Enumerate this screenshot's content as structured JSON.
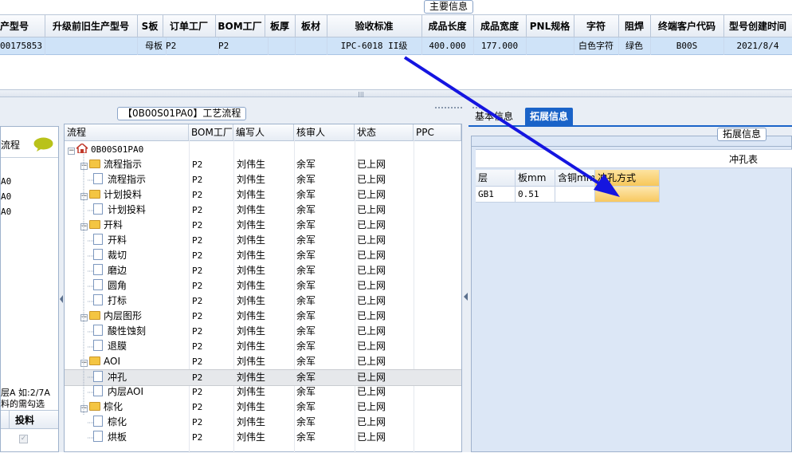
{
  "top": {
    "group_label": "主要信息",
    "headers": [
      "产型号",
      "升级前旧生产型号",
      "S板",
      "订单工厂",
      "BOM工厂",
      "板厚",
      "板材",
      "验收标准",
      "成品长度",
      "成品宽度",
      "PNL规格",
      "字符",
      "阻焊",
      "终端客户代码",
      "型号创建时间"
    ],
    "row": [
      "00175853",
      "",
      "母板",
      "P2",
      "P2",
      "",
      "",
      "IPC-6018 II级",
      "400.000",
      "177.000",
      "",
      "白色字符",
      "绿色",
      "B00S",
      "2021/8/4"
    ]
  },
  "left": {
    "label_process": "流程",
    "items": [
      "A0",
      "A0",
      "A0"
    ],
    "note_line1": "层A 如:2/7A",
    "note_line2": "料的需勾选",
    "col_header": "投料"
  },
  "tree": {
    "group_label": "【0B00S01PA0】工艺流程",
    "headers": [
      "流程",
      "BOM工厂",
      "编写人",
      "核审人",
      "状态",
      "PPC"
    ],
    "root": "0B00S01PA0",
    "rows": [
      {
        "label": "流程指示",
        "type": "folder",
        "bom": "P2",
        "writer": "刘伟生",
        "reviewer": "余军",
        "status": "已上网"
      },
      {
        "label": "流程指示",
        "type": "doc",
        "bom": "P2",
        "writer": "刘伟生",
        "reviewer": "余军",
        "status": "已上网"
      },
      {
        "label": "计划投料",
        "type": "folder",
        "bom": "P2",
        "writer": "刘伟生",
        "reviewer": "余军",
        "status": "已上网"
      },
      {
        "label": "计划投料",
        "type": "doc",
        "bom": "P2",
        "writer": "刘伟生",
        "reviewer": "余军",
        "status": "已上网"
      },
      {
        "label": "开料",
        "type": "folder",
        "bom": "P2",
        "writer": "刘伟生",
        "reviewer": "余军",
        "status": "已上网"
      },
      {
        "label": "开料",
        "type": "doc",
        "bom": "P2",
        "writer": "刘伟生",
        "reviewer": "余军",
        "status": "已上网"
      },
      {
        "label": "裁切",
        "type": "doc",
        "bom": "P2",
        "writer": "刘伟生",
        "reviewer": "余军",
        "status": "已上网"
      },
      {
        "label": "磨边",
        "type": "doc",
        "bom": "P2",
        "writer": "刘伟生",
        "reviewer": "余军",
        "status": "已上网"
      },
      {
        "label": "圆角",
        "type": "doc",
        "bom": "P2",
        "writer": "刘伟生",
        "reviewer": "余军",
        "status": "已上网"
      },
      {
        "label": "打标",
        "type": "doc",
        "bom": "P2",
        "writer": "刘伟生",
        "reviewer": "余军",
        "status": "已上网"
      },
      {
        "label": "内层图形",
        "type": "folder",
        "bom": "P2",
        "writer": "刘伟生",
        "reviewer": "余军",
        "status": "已上网"
      },
      {
        "label": "酸性蚀刻",
        "type": "doc",
        "bom": "P2",
        "writer": "刘伟生",
        "reviewer": "余军",
        "status": "已上网"
      },
      {
        "label": "退膜",
        "type": "doc",
        "bom": "P2",
        "writer": "刘伟生",
        "reviewer": "余军",
        "status": "已上网"
      },
      {
        "label": "AOI",
        "type": "folder",
        "bom": "P2",
        "writer": "刘伟生",
        "reviewer": "余军",
        "status": "已上网"
      },
      {
        "label": "冲孔",
        "type": "doc",
        "bom": "P2",
        "writer": "刘伟生",
        "reviewer": "余军",
        "status": "已上网",
        "selected": true
      },
      {
        "label": "内层AOI",
        "type": "doc",
        "bom": "P2",
        "writer": "刘伟生",
        "reviewer": "余军",
        "status": "已上网"
      },
      {
        "label": "棕化",
        "type": "folder",
        "bom": "P2",
        "writer": "刘伟生",
        "reviewer": "余军",
        "status": "已上网"
      },
      {
        "label": "棕化",
        "type": "doc",
        "bom": "P2",
        "writer": "刘伟生",
        "reviewer": "余军",
        "status": "已上网"
      },
      {
        "label": "烘板",
        "type": "doc",
        "bom": "P2",
        "writer": "刘伟生",
        "reviewer": "余军",
        "status": "已上网"
      }
    ]
  },
  "right": {
    "tabs": [
      "基本信息",
      "拓展信息"
    ],
    "active_tab": 1,
    "group_label": "拓展信息",
    "table_title": "冲孔表",
    "headers": [
      "层",
      "板mm",
      "含铜mm",
      "冲孔方式"
    ],
    "row": [
      "GB1",
      "0.51",
      "",
      ""
    ]
  },
  "colors": {
    "accent": "#1a63c8",
    "arrow": "#1515e0",
    "selected_row": "#cfe3f8",
    "highlight_cell": "#f7c75a"
  }
}
